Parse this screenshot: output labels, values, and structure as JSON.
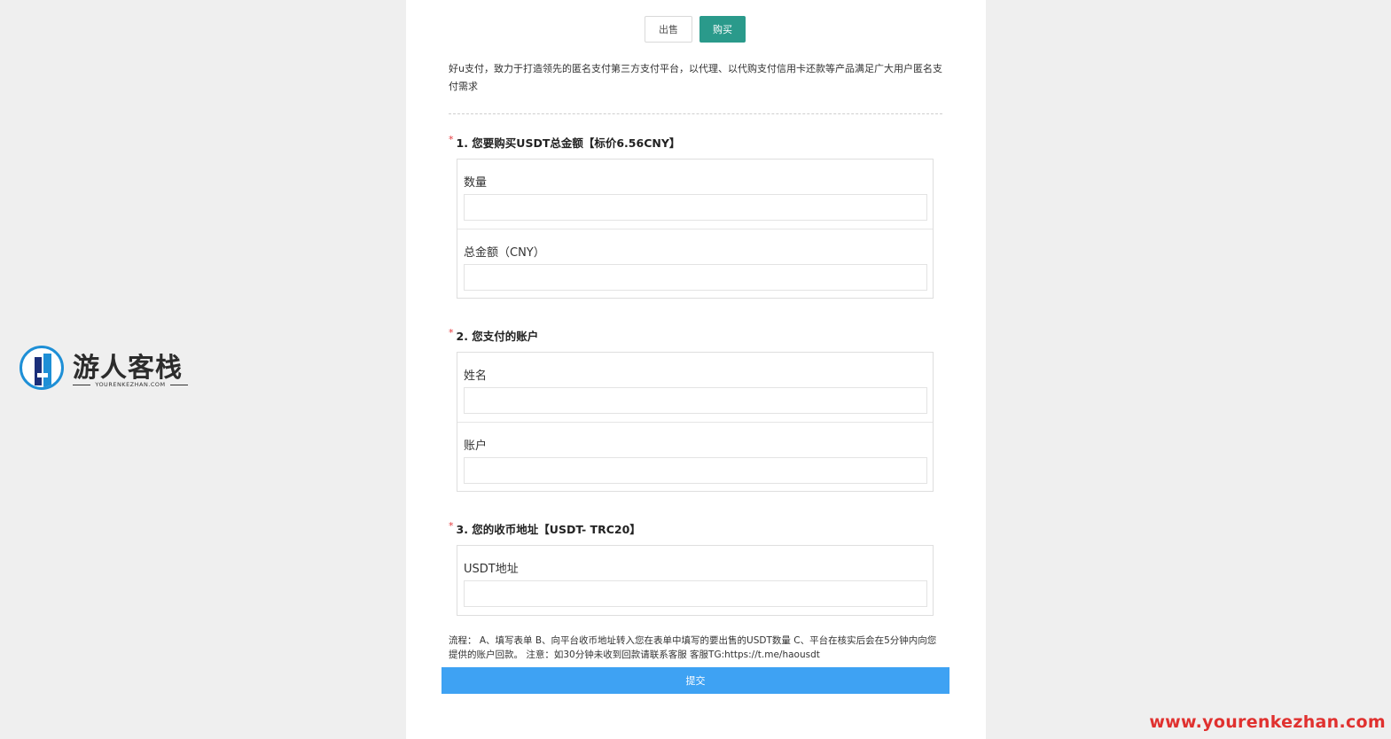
{
  "tabs": {
    "sell": "出售",
    "buy": "购买"
  },
  "intro": "好u支付，致力于打造领先的匿名支付第三方支付平台，以代理、以代购支付信用卡还款等产品满足广大用户匿名支付需求",
  "sections": [
    {
      "title": "1. 您要购买USDT总金额【标价6.56CNY】",
      "fields": [
        {
          "label": "数量",
          "value": ""
        },
        {
          "label": "总金额（CNY）",
          "value": ""
        }
      ]
    },
    {
      "title": "2. 您支付的账户",
      "fields": [
        {
          "label": "姓名",
          "value": ""
        },
        {
          "label": "账户",
          "value": ""
        }
      ]
    },
    {
      "title": "3. 您的收币地址【USDT- TRC20】",
      "fields": [
        {
          "label": "USDT地址",
          "value": ""
        }
      ]
    }
  ],
  "required_mark": "*",
  "notes": "流程： A、填写表单 B、向平台收币地址转入您在表单中填写的要出售的USDT数量 C、平台在核实后会在5分钟内向您提供的账户回款。 注意：如30分钟未收到回款请联系客服 客服TG:https://t.me/haousdt",
  "submit_label": "提交",
  "logo": {
    "name": "游人客栈",
    "domain": "YOURENKEZHAN.COM"
  },
  "watermark": "www.yourenkezhan.com",
  "colors": {
    "buy_tab": "#2a9a8b",
    "submit": "#3ea2f3",
    "required": "#e4393c",
    "watermark": "#e0312f"
  }
}
